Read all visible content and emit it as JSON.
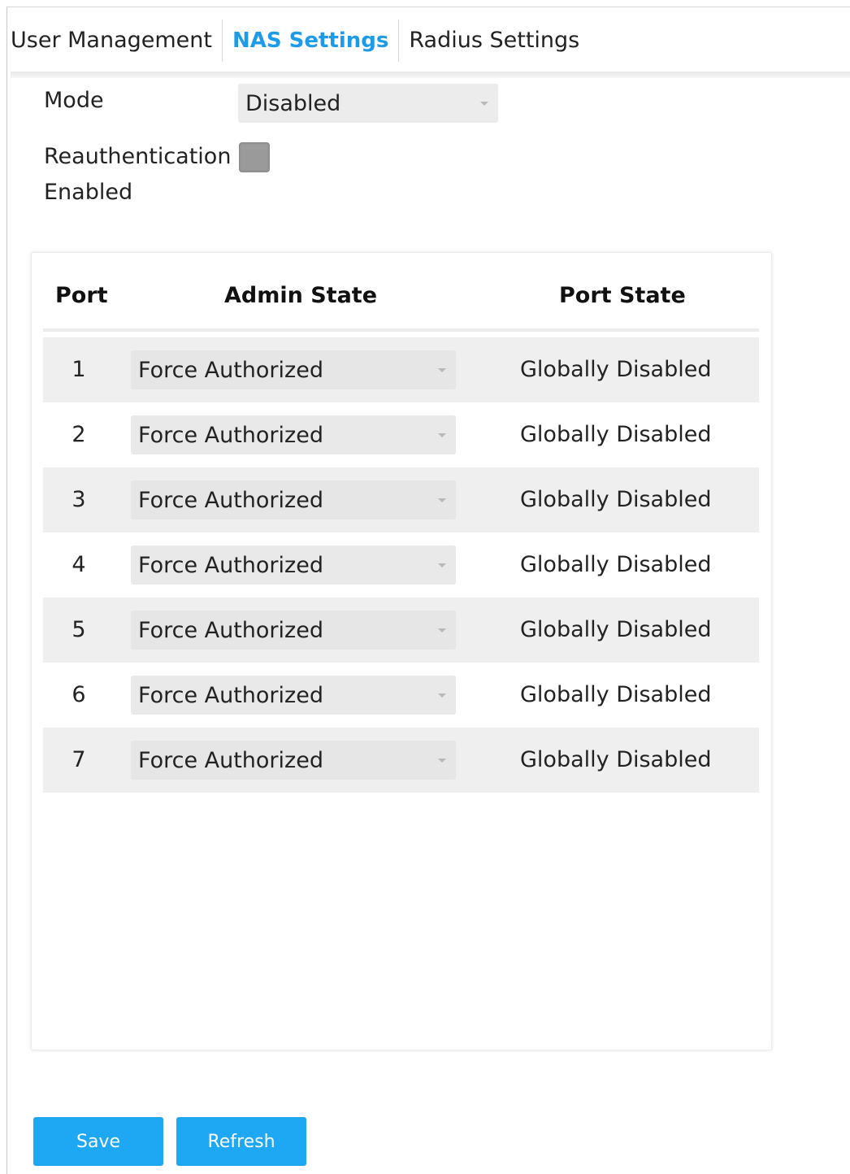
{
  "tabs": [
    {
      "label": "User Management"
    },
    {
      "label": "NAS Settings"
    },
    {
      "label": "Radius Settings"
    }
  ],
  "form": {
    "mode_label": "Mode",
    "mode_value": "Disabled",
    "reauth_label_line1": "Reauthentication",
    "reauth_label_line2": "Enabled",
    "reauth_checked": false
  },
  "table": {
    "headers": {
      "port": "Port",
      "admin_state": "Admin State",
      "port_state": "Port State"
    },
    "rows": [
      {
        "port": "1",
        "admin_state": "Force Authorized",
        "port_state": "Globally Disabled"
      },
      {
        "port": "2",
        "admin_state": "Force Authorized",
        "port_state": "Globally Disabled"
      },
      {
        "port": "3",
        "admin_state": "Force Authorized",
        "port_state": "Globally Disabled"
      },
      {
        "port": "4",
        "admin_state": "Force Authorized",
        "port_state": "Globally Disabled"
      },
      {
        "port": "5",
        "admin_state": "Force Authorized",
        "port_state": "Globally Disabled"
      },
      {
        "port": "6",
        "admin_state": "Force Authorized",
        "port_state": "Globally Disabled"
      },
      {
        "port": "7",
        "admin_state": "Force Authorized",
        "port_state": "Globally Disabled"
      }
    ]
  },
  "buttons": {
    "save": "Save",
    "refresh": "Refresh"
  },
  "colors": {
    "accent": "#1e9be8",
    "button": "#1ea7f2",
    "row_shade": "#efefef"
  }
}
